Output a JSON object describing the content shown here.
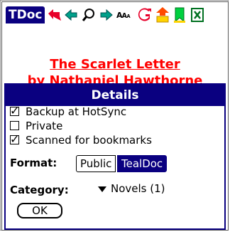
{
  "app": {
    "title": "TDoc"
  },
  "toolbar": {
    "icons": [
      "back-arrow-icon",
      "prev-page-icon",
      "search-icon",
      "next-page-icon",
      "font-size-icon",
      "go-icon",
      "bookmark-up-icon",
      "bookmark-icon",
      "close-icon"
    ]
  },
  "document": {
    "title_line1": "The Scarlet Letter",
    "title_line2": "by Nathaniel Hawthorne"
  },
  "dialog": {
    "title": "Details",
    "options": [
      {
        "label": "Backup at HotSync",
        "checked": true
      },
      {
        "label": "Private",
        "checked": false
      },
      {
        "label": "Scanned for bookmarks",
        "checked": true
      }
    ],
    "format_label": "Format:",
    "format_options": [
      "Public",
      "TealDoc"
    ],
    "format_selected": "TealDoc",
    "category_label": "Category:",
    "category_value": "Novels (1)",
    "ok_label": "OK"
  },
  "colors": {
    "accent": "#0a0080",
    "title_red": "#ff0000"
  }
}
